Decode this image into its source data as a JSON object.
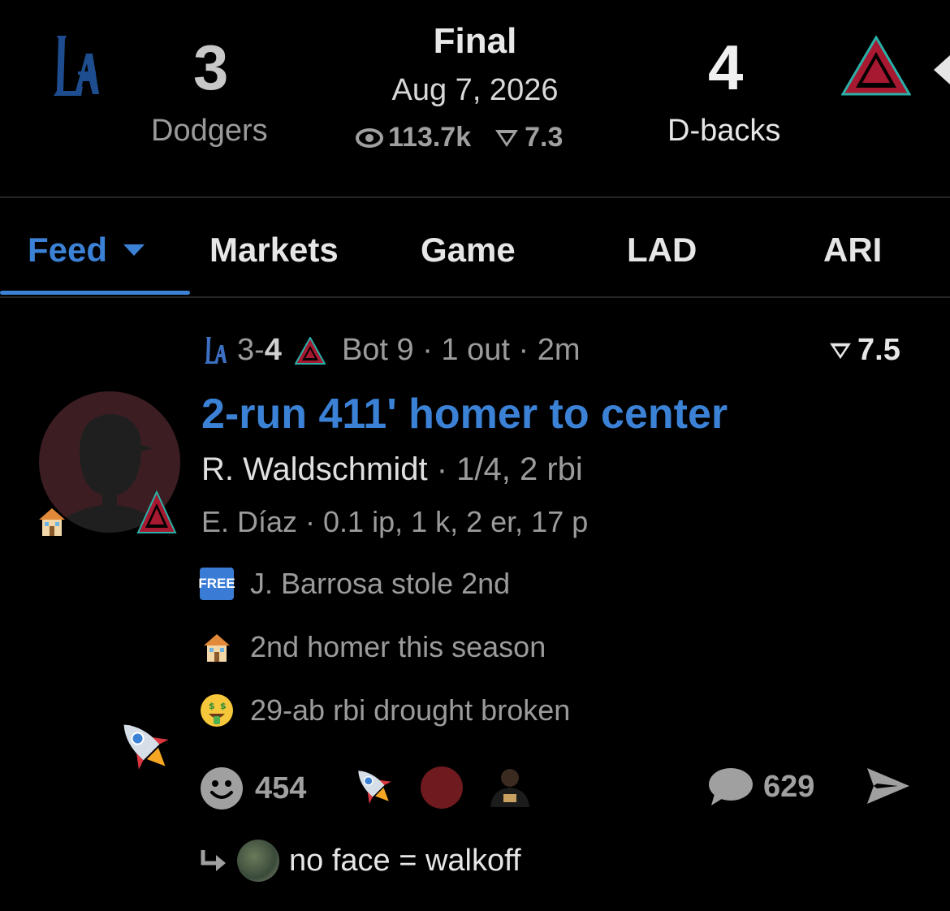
{
  "header": {
    "away": {
      "abbr": "LA",
      "score": "3",
      "name": "Dodgers",
      "color": "#1e4d8f"
    },
    "home": {
      "abbr": "A",
      "score": "4",
      "name": "D-backs",
      "color": "#a71930"
    },
    "status": "Final",
    "date": "Aug 7, 2026",
    "views": "113.7k",
    "rating": "7.3"
  },
  "tabs": [
    {
      "label": "Feed",
      "active": true
    },
    {
      "label": "Markets"
    },
    {
      "label": "Game"
    },
    {
      "label": "LAD"
    },
    {
      "label": "ARI"
    }
  ],
  "post": {
    "score_away": "3",
    "score_sep": "-",
    "score_home": "4",
    "situation": "Bot 9 · 1 out · 2m",
    "rating": "7.5",
    "headline": "2-run 411' homer to center",
    "batter_name": "R. Waldschmidt",
    "batter_stats": " · 1/4, 2 rbi",
    "pitcher_line": "E. Díaz · 0.1 ip, 1 k, 2 er, 17 p",
    "notes": [
      {
        "icon": "free-icon",
        "icon_text": "FREE",
        "text": "J. Barrosa stole 2nd"
      },
      {
        "icon": "house-icon",
        "text": "2nd homer this season"
      },
      {
        "icon": "money-face-icon",
        "text": "29-ab rbi drought broken"
      }
    ],
    "reactions_count": "454",
    "comments_count": "629",
    "reply_text": "no face = walkoff"
  },
  "colors": {
    "accent": "#3b82d6",
    "background": "#000000",
    "muted": "#9b9b9b"
  }
}
